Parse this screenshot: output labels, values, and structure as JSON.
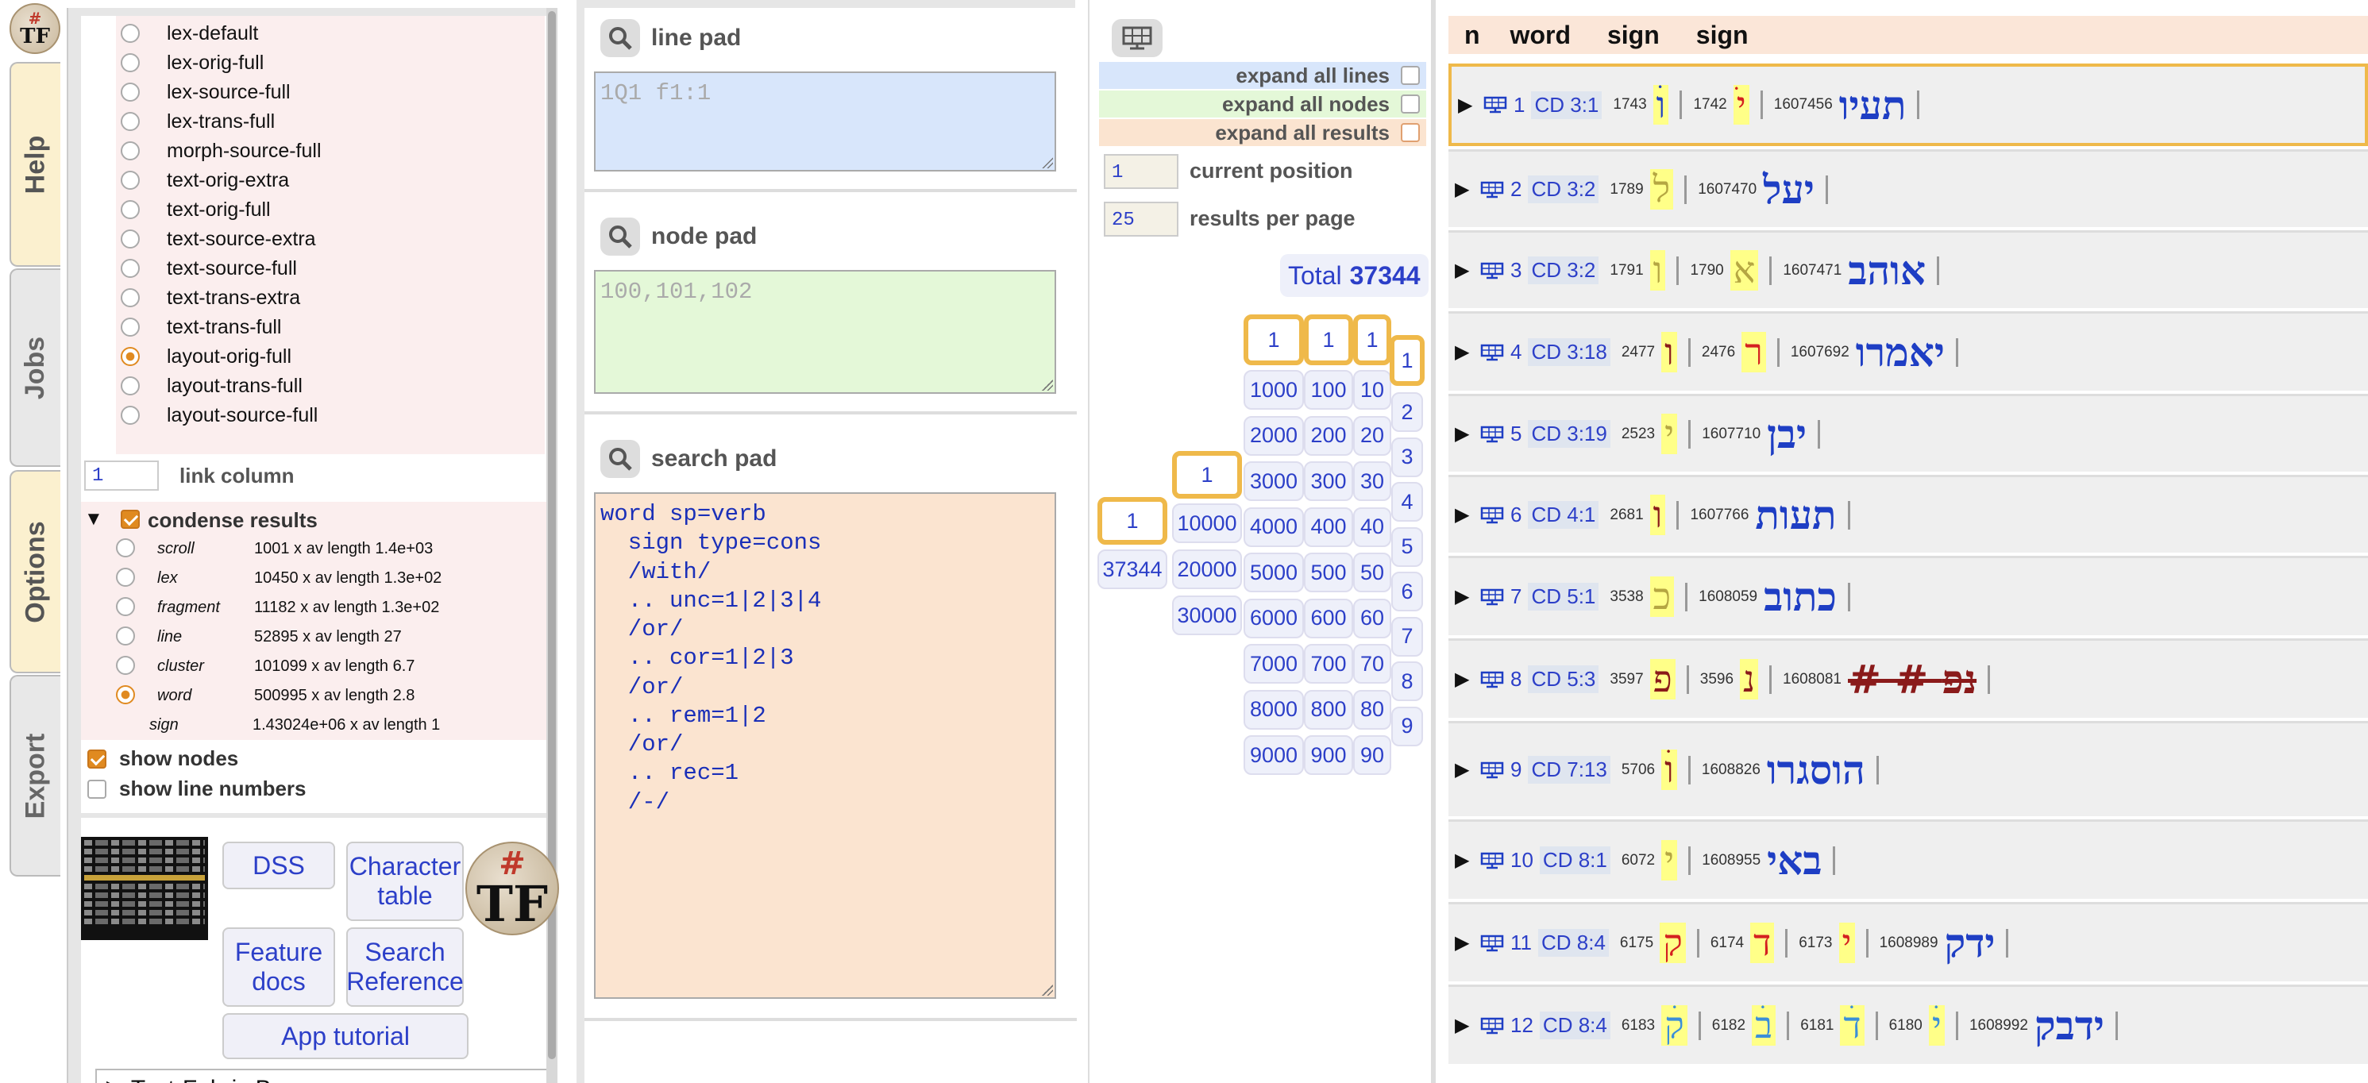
{
  "tabs": {
    "help": "Help",
    "jobs": "Jobs",
    "options": "Options",
    "export": "Export"
  },
  "logo": {
    "hash": "#",
    "letters": "TF"
  },
  "formats": [
    {
      "label": "lex-default",
      "selected": false
    },
    {
      "label": "lex-orig-full",
      "selected": false
    },
    {
      "label": "lex-source-full",
      "selected": false
    },
    {
      "label": "lex-trans-full",
      "selected": false
    },
    {
      "label": "morph-source-full",
      "selected": false
    },
    {
      "label": "text-orig-extra",
      "selected": false
    },
    {
      "label": "text-orig-full",
      "selected": false
    },
    {
      "label": "text-source-extra",
      "selected": false
    },
    {
      "label": "text-source-full",
      "selected": false
    },
    {
      "label": "text-trans-extra",
      "selected": false
    },
    {
      "label": "text-trans-full",
      "selected": false
    },
    {
      "label": "layout-orig-full",
      "selected": true
    },
    {
      "label": "layout-trans-full",
      "selected": false
    },
    {
      "label": "layout-source-full",
      "selected": false
    }
  ],
  "link_column": {
    "value": "1",
    "label": "link column"
  },
  "condense": {
    "label": "condense results",
    "checked": true,
    "types": [
      {
        "name": "scroll",
        "info": "1001 x av length 1.4e+03",
        "selected": false
      },
      {
        "name": "lex",
        "info": "10450 x av length 1.3e+02",
        "selected": false
      },
      {
        "name": "fragment",
        "info": "11182 x av length 1.3e+02",
        "selected": false
      },
      {
        "name": "line",
        "info": "52895 x av length 27",
        "selected": false
      },
      {
        "name": "cluster",
        "info": "101099 x av length 6.7",
        "selected": false
      },
      {
        "name": "word",
        "info": "500995 x av length 2.8",
        "selected": true
      },
      {
        "name": "sign",
        "info": "1.43024e+06 x av length 1",
        "selected": false
      }
    ]
  },
  "show_nodes": {
    "label": "show nodes",
    "checked": true
  },
  "show_line_numbers": {
    "label": "show line numbers",
    "checked": false
  },
  "buttons": {
    "dss": "DSS",
    "character_table": "Character table",
    "feature_docs": "Feature docs",
    "search_reference": "Search Reference",
    "app_tutorial": "App tutorial"
  },
  "browser": {
    "label": "Text-Fabric Browser"
  },
  "pads": {
    "line": {
      "title": "line pad",
      "placeholder": "1Q1 f1:1"
    },
    "node": {
      "title": "node pad",
      "placeholder": "100,101,102"
    },
    "search": {
      "title": "search pad",
      "query": "word sp=verb\n  sign type=cons\n  /with/\n  .. unc=1|2|3|4\n  /or/\n  .. cor=1|2|3\n  /or/\n  .. rem=1|2\n  /or/\n  .. rec=1\n  /-/"
    }
  },
  "expand": {
    "lines": "expand all lines",
    "nodes": "expand all nodes",
    "results": "expand all results"
  },
  "position": {
    "value": "1",
    "label": "current position"
  },
  "per_page": {
    "value": "25",
    "label": "results per page"
  },
  "total": {
    "label": "Total",
    "value": "37344"
  },
  "nav": {
    "col_ten_thousands": [
      "1",
      "37344"
    ],
    "col_thousands_wide": [
      "1",
      "10000",
      "20000",
      "30000"
    ],
    "col_thousands": [
      "1",
      "1000",
      "2000",
      "3000",
      "4000",
      "5000",
      "6000",
      "7000",
      "8000",
      "9000"
    ],
    "col_hundreds": [
      "1",
      "100",
      "200",
      "300",
      "400",
      "500",
      "600",
      "700",
      "800",
      "900"
    ],
    "col_tens": [
      "1",
      "10",
      "20",
      "30",
      "40",
      "50",
      "60",
      "70",
      "80",
      "90"
    ],
    "col_units": [
      "1",
      "2",
      "3",
      "4",
      "5",
      "6",
      "7",
      "8",
      "9"
    ]
  },
  "results_header": {
    "n": "n",
    "word": "word",
    "sign1": "sign",
    "sign2": "sign"
  },
  "results": [
    {
      "n": "1",
      "ref": "CD 3:1",
      "signs": [
        {
          "id": "1743",
          "ch": "וׄ",
          "cls": "c-blue"
        },
        {
          "id": "1742",
          "ch": "ׄי",
          "cls": "c-red"
        }
      ],
      "word_id": "1607456",
      "word": "תעיו"
    },
    {
      "n": "2",
      "ref": "CD 3:2",
      "signs": [
        {
          "id": "1789",
          "ch": "ל",
          "cls": "c-olive"
        }
      ],
      "word_id": "1607470",
      "word": "יעל"
    },
    {
      "n": "3",
      "ref": "CD 3:2",
      "signs": [
        {
          "id": "1791",
          "ch": "ו",
          "cls": "c-olive"
        },
        {
          "id": "1790",
          "ch": "א",
          "cls": "c-olive"
        }
      ],
      "word_id": "1607471",
      "word": "אוהב"
    },
    {
      "n": "4",
      "ref": "CD 3:18",
      "signs": [
        {
          "id": "2477",
          "ch": "ו",
          "cls": "c-dk"
        },
        {
          "id": "2476",
          "ch": "ר",
          "cls": "c-red"
        }
      ],
      "word_id": "1607692",
      "word": "יאמרו"
    },
    {
      "n": "5",
      "ref": "CD 3:19",
      "signs": [
        {
          "id": "2523",
          "ch": "י",
          "cls": "c-olive"
        }
      ],
      "word_id": "1607710",
      "word": "יבן"
    },
    {
      "n": "6",
      "ref": "CD 4:1",
      "signs": [
        {
          "id": "2681",
          "ch": "ו",
          "cls": "c-dk"
        }
      ],
      "word_id": "1607766",
      "word": "תעות"
    },
    {
      "n": "7",
      "ref": "CD 5:1",
      "signs": [
        {
          "id": "3538",
          "ch": "כ",
          "cls": "c-olive"
        }
      ],
      "word_id": "1608059",
      "word": "כתוב"
    },
    {
      "n": "8",
      "ref": "CD 5:3",
      "signs": [
        {
          "id": "3597",
          "ch": "פ",
          "cls": "c-dk"
        },
        {
          "id": "3596",
          "ch": "נ",
          "cls": "c-dk"
        }
      ],
      "word_id": "1608081",
      "word": "# # נפ"
    },
    {
      "n": "9",
      "ref": "CD 7:13",
      "signs": [
        {
          "id": "5706",
          "ch": "וׄ",
          "cls": "c-dk"
        }
      ],
      "word_id": "1608826",
      "word": "הוסגרו"
    },
    {
      "n": "10",
      "ref": "CD 8:1",
      "signs": [
        {
          "id": "6072",
          "ch": "י",
          "cls": "c-olive"
        }
      ],
      "word_id": "1608955",
      "word": "באי"
    },
    {
      "n": "11",
      "ref": "CD 8:4",
      "signs": [
        {
          "id": "6175",
          "ch": "ק",
          "cls": "c-red"
        },
        {
          "id": "6174",
          "ch": "ד",
          "cls": "c-red"
        },
        {
          "id": "6173",
          "ch": "י",
          "cls": "c-red"
        }
      ],
      "word_id": "1608989",
      "word": "ידק"
    },
    {
      "n": "12",
      "ref": "CD 8:4",
      "signs": [
        {
          "id": "6183",
          "ch": "קׄ",
          "cls": "c-lblue"
        },
        {
          "id": "6182",
          "ch": "בׄ",
          "cls": "c-lblue"
        },
        {
          "id": "6181",
          "ch": "דׄ",
          "cls": "c-lblue"
        },
        {
          "id": "6180",
          "ch": "יׄ",
          "cls": "c-lblue"
        }
      ],
      "word_id": "1608992",
      "word": "ידבק"
    }
  ]
}
